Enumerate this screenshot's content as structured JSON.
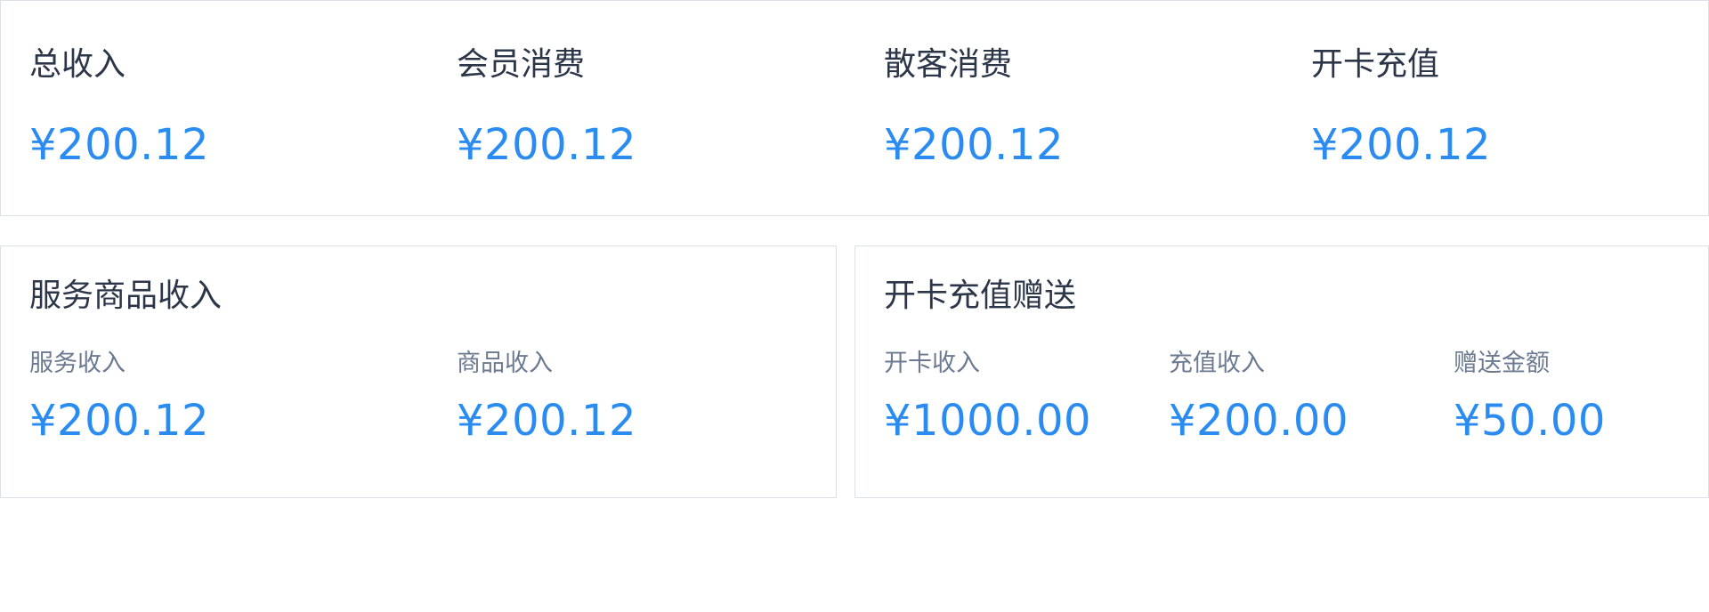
{
  "summary": {
    "items": [
      {
        "label": "总收入",
        "amount": "¥200.12"
      },
      {
        "label": "会员消费",
        "amount": "¥200.12"
      },
      {
        "label": "散客消费",
        "amount": "¥200.12"
      },
      {
        "label": "开卡充值",
        "amount": "¥200.12"
      }
    ]
  },
  "service_goods": {
    "title": "服务商品收入",
    "items": [
      {
        "label": "服务收入",
        "amount": "¥200.12"
      },
      {
        "label": "商品收入",
        "amount": "¥200.12"
      }
    ]
  },
  "card_gift": {
    "title": "开卡充值赠送",
    "items": [
      {
        "label": "开卡收入",
        "amount": "¥1000.00"
      },
      {
        "label": "充值收入",
        "amount": "¥200.00"
      },
      {
        "label": "赠送金额",
        "amount": "¥50.00"
      }
    ]
  },
  "colors": {
    "amount": "#2a8cf0",
    "title": "#2b3648",
    "sub_label": "#6b7a90",
    "border": "#dcdfe6"
  }
}
